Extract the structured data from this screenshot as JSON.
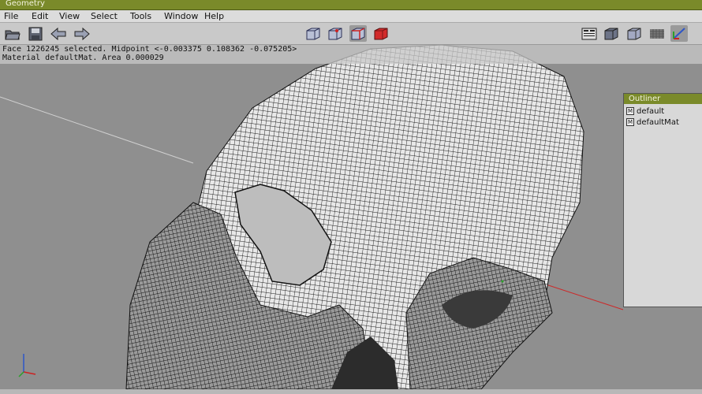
{
  "window": {
    "title": "Geometry"
  },
  "menu": [
    "File",
    "Edit",
    "View",
    "Select",
    "Tools",
    "Window",
    "Help"
  ],
  "toolbar": {
    "left_icons": [
      "folder-open-icon",
      "save-icon",
      "arrow-left-icon",
      "arrow-right-icon"
    ],
    "center_icons": [
      "wire-cube-icon",
      "vertex-cube-icon",
      "edge-cube-icon",
      "face-cube-icon"
    ],
    "right_icons": [
      "panel-layout-icon",
      "solid-cube-icon",
      "shaded-cube-icon",
      "texture-grid-icon",
      "axes-icon"
    ]
  },
  "info": {
    "line1": "Face 1226245 selected. Midpoint <-0.003375  0.108362  -0.075205>",
    "line2": "Material defaultMat. Area 0.000029"
  },
  "outliner": {
    "title": "Outliner",
    "items": [
      {
        "badge": "M",
        "label": "default"
      },
      {
        "badge": "M",
        "label": "defaultMat"
      }
    ]
  },
  "colors": {
    "accent": "#7a8a2a",
    "selection": "#cc2222",
    "viewport": "#8f8f8f"
  }
}
